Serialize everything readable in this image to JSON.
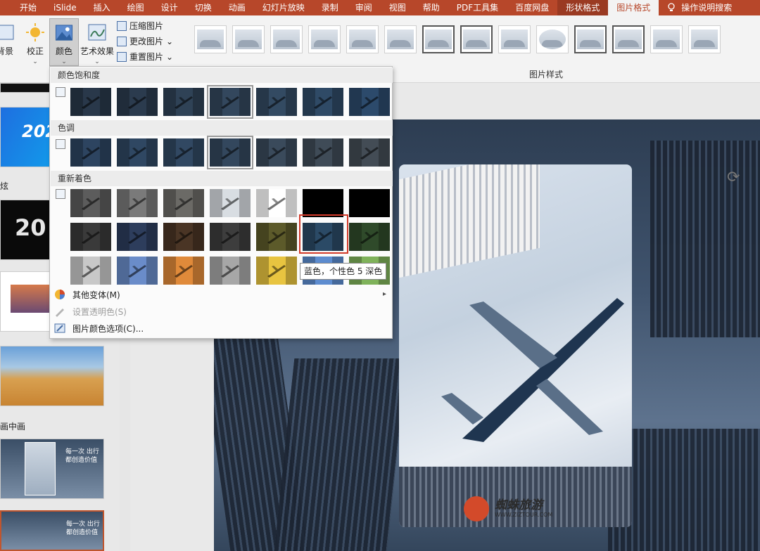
{
  "menubar": {
    "tabs": [
      "开始",
      "iSlide",
      "插入",
      "绘图",
      "设计",
      "切换",
      "动画",
      "幻灯片放映",
      "录制",
      "审阅",
      "视图",
      "帮助",
      "PDF工具集",
      "百度网盘",
      "形状格式",
      "图片格式",
      "操作说明搜索"
    ],
    "active_tab": "图片格式"
  },
  "ribbon": {
    "background_label": "背景",
    "correct_label": "校正",
    "color_label": "颜色",
    "art_label": "艺术效果",
    "compress_label": "压缩图片",
    "change_label": "更改图片",
    "reset_label": "重置图片",
    "styles_group_label": "图片样式"
  },
  "dropdown": {
    "saturation_header": "颜色饱和度",
    "tone_header": "色调",
    "recolor_header": "重新着色",
    "more_variants": "其他变体(M)",
    "set_transparent": "设置透明色(S)",
    "color_options": "图片颜色选项(C)...",
    "tooltip": "蓝色，个性色 5 深色"
  },
  "swatch_colors": {
    "saturation": [
      "#29384a",
      "#2b3b4e",
      "#2f4256",
      "#33475d",
      "#334a62",
      "#2f4a66",
      "#2c4a6b"
    ],
    "tone": [
      "#2d4460",
      "#2f4762",
      "#314862",
      "#33475d",
      "#3a4a5b",
      "#3f4b57",
      "#434c55"
    ],
    "recolor_row1": [
      "#5c5c5c",
      "#7a7a7a",
      "#6b6a66",
      "#d8dde2",
      "#ffffff",
      "#000000",
      "#000000"
    ],
    "recolor_row2": [
      "#3a3a3a",
      "#2d3d5c",
      "#4a3525",
      "#3d3d3d",
      "#5c5a2a",
      "#2b4a66",
      "#2f4a2a"
    ],
    "recolor_row3": [
      "#c8c8c8",
      "#6a8cc9",
      "#e08a3a",
      "#a7a7a7",
      "#e8c440",
      "#5d8ccf",
      "#7fb25a"
    ]
  },
  "left_panel": {
    "slide1_title": "202",
    "slide3_title": "20",
    "section1": "炫",
    "section2": "画中画",
    "slide_caption": "每一次 出行 都创造价值"
  },
  "card": {
    "brand": "蜘蛛旅游",
    "url": "WWW.ZIZTOUR.COM"
  }
}
